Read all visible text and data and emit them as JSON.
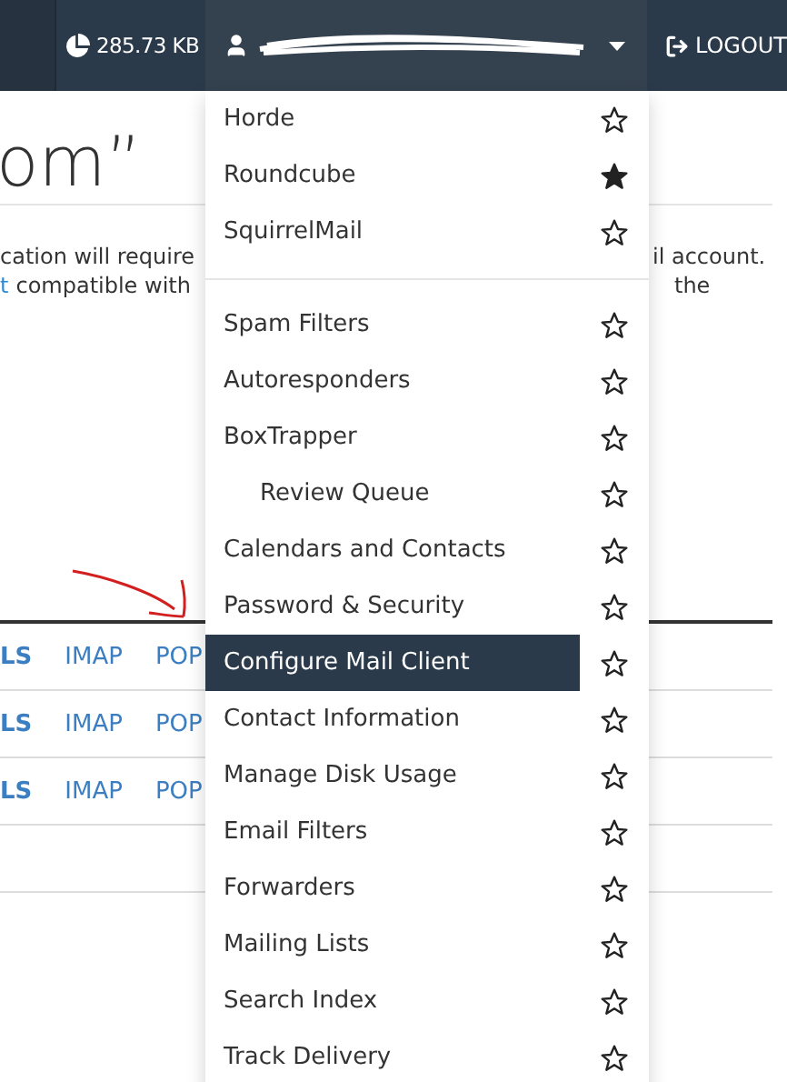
{
  "top_bar": {
    "disk_usage": "285.73 KB",
    "logout": "LOGOUT"
  },
  "page": {
    "heading_fragment": "om”",
    "paragraph_left": [
      "cation will require",
      "compatible with"
    ],
    "paragraph_left_link": "t",
    "paragraph_right": [
      "il account.",
      "the"
    ],
    "rows": [
      {
        "cells": [
          "LS",
          "IMAP",
          "POP"
        ]
      },
      {
        "cells": [
          "LS",
          "IMAP",
          "POP"
        ]
      },
      {
        "cells": [
          "LS",
          "IMAP",
          "POP"
        ]
      }
    ]
  },
  "menu": {
    "items": [
      {
        "kind": "link",
        "label": "Horde",
        "starred": false,
        "selected": false
      },
      {
        "kind": "link",
        "label": "Roundcube",
        "starred": true,
        "selected": false
      },
      {
        "kind": "link",
        "label": "SquirrelMail",
        "starred": false,
        "selected": false
      },
      {
        "kind": "divider"
      },
      {
        "kind": "link",
        "label": "Spam Filters",
        "starred": false,
        "selected": false
      },
      {
        "kind": "link",
        "label": "Autoresponders",
        "starred": false,
        "selected": false
      },
      {
        "kind": "link",
        "label": "BoxTrapper",
        "starred": false,
        "selected": false,
        "children": [
          {
            "kind": "link",
            "label": "Review Queue",
            "starred": false,
            "selected": false
          }
        ]
      },
      {
        "kind": "link",
        "label": "Calendars and Contacts",
        "starred": false,
        "selected": false
      },
      {
        "kind": "link",
        "label": "Password & Security",
        "starred": false,
        "selected": false
      },
      {
        "kind": "link",
        "label": "Configure Mail Client",
        "starred": false,
        "selected": true
      },
      {
        "kind": "link",
        "label": "Contact Information",
        "starred": false,
        "selected": false
      },
      {
        "kind": "link",
        "label": "Manage Disk Usage",
        "starred": false,
        "selected": false
      },
      {
        "kind": "link",
        "label": "Email Filters",
        "starred": false,
        "selected": false
      },
      {
        "kind": "link",
        "label": "Forwarders",
        "starred": false,
        "selected": false
      },
      {
        "kind": "link",
        "label": "Mailing Lists",
        "starred": false,
        "selected": false
      },
      {
        "kind": "link",
        "label": "Search Index",
        "starred": false,
        "selected": false
      },
      {
        "kind": "link",
        "label": "Track Delivery",
        "starred": false,
        "selected": false
      }
    ]
  }
}
